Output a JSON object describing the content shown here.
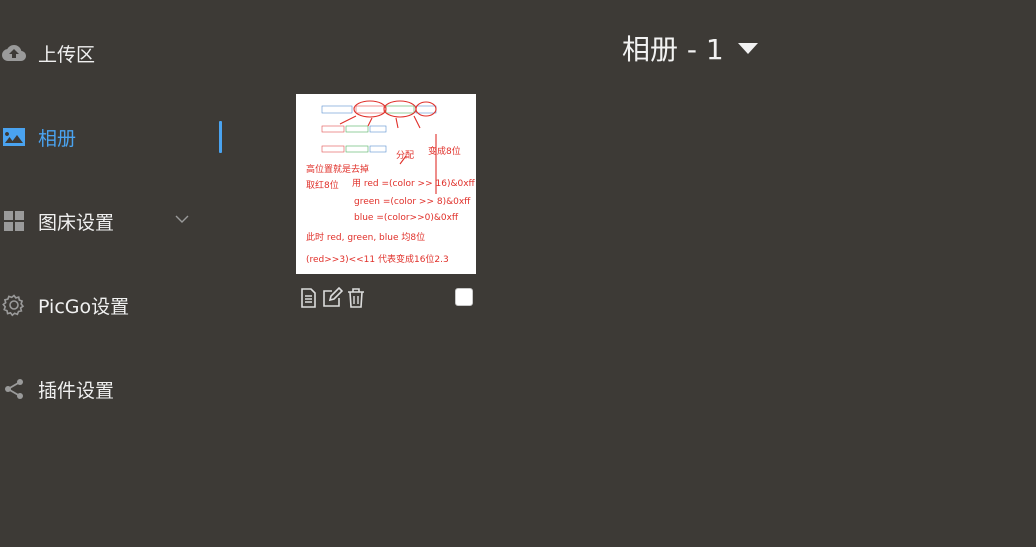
{
  "sidebar": {
    "items": [
      {
        "label": "上传区",
        "icon": "cloud-upload-icon"
      },
      {
        "label": "相册",
        "icon": "image-icon",
        "active": true
      },
      {
        "label": "图床设置",
        "icon": "grid-icon",
        "expandable": true
      },
      {
        "label": "PicGo设置",
        "icon": "gear-icon"
      },
      {
        "label": "插件设置",
        "icon": "share-icon"
      }
    ]
  },
  "gallery": {
    "title": "相册 - 1",
    "images": [
      {
        "actions": [
          "copy-link-icon",
          "edit-icon",
          "delete-icon"
        ],
        "selected": false,
        "note_lines": [
          "高位置就是去掉",
          "取红8位",
          "用 red = (color >> 16) & 0xff",
          "green = (color >> 8) & 0xff",
          "blue = (color >> 0) & 0xff",
          "此时 red, green, blue 均8位",
          "(red >> 3) << 11   代表变成16位2.3"
        ]
      }
    ]
  },
  "colors": {
    "background": "#3d3a36",
    "accent": "#4aa3f0",
    "text": "#f0f0f0",
    "icon": "#9a9a9a"
  }
}
